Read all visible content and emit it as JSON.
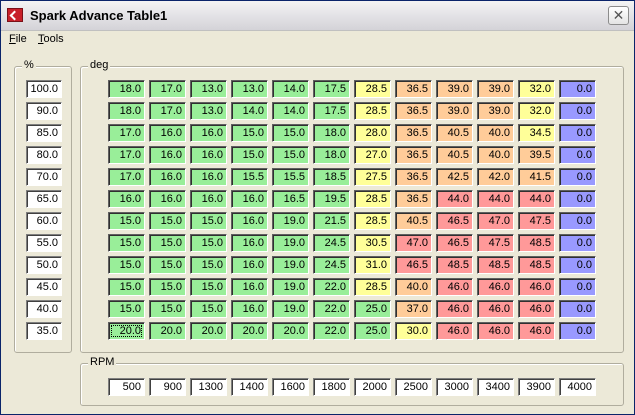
{
  "window": {
    "title": "Spark Advance Table1",
    "close_glyph": "✕"
  },
  "menu": [
    {
      "key": "F",
      "rest": "ile"
    },
    {
      "key": "T",
      "rest": "ools"
    }
  ],
  "groups": {
    "percent_label": "%",
    "table_label": "deg",
    "rpm_label": "RPM"
  },
  "percent": [
    "100.0",
    "90.0",
    "85.0",
    "80.0",
    "70.0",
    "65.0",
    "60.0",
    "55.0",
    "50.0",
    "45.0",
    "40.0",
    "35.0"
  ],
  "rpm": [
    "500",
    "900",
    "1300",
    "1400",
    "1600",
    "1800",
    "2000",
    "2500",
    "3000",
    "3400",
    "3900",
    "4000"
  ],
  "table": [
    [
      "18.0",
      "17.0",
      "13.0",
      "13.0",
      "14.0",
      "17.5",
      "28.5",
      "36.5",
      "39.0",
      "39.0",
      "32.0",
      "0.0"
    ],
    [
      "18.0",
      "17.0",
      "13.0",
      "14.0",
      "14.0",
      "17.5",
      "28.5",
      "36.5",
      "39.0",
      "39.0",
      "32.0",
      "0.0"
    ],
    [
      "17.0",
      "16.0",
      "16.0",
      "15.0",
      "15.0",
      "18.0",
      "28.0",
      "36.5",
      "40.5",
      "40.0",
      "34.5",
      "0.0"
    ],
    [
      "17.0",
      "16.0",
      "16.0",
      "15.0",
      "15.0",
      "18.0",
      "27.0",
      "36.5",
      "40.5",
      "40.0",
      "39.5",
      "0.0"
    ],
    [
      "17.0",
      "16.0",
      "16.0",
      "15.5",
      "15.5",
      "18.5",
      "27.5",
      "36.5",
      "42.5",
      "42.0",
      "41.5",
      "0.0"
    ],
    [
      "16.0",
      "16.0",
      "16.0",
      "16.0",
      "16.5",
      "19.5",
      "28.5",
      "36.5",
      "44.0",
      "44.0",
      "44.0",
      "0.0"
    ],
    [
      "15.0",
      "15.0",
      "15.0",
      "16.0",
      "19.0",
      "21.5",
      "28.5",
      "40.5",
      "46.5",
      "47.0",
      "47.5",
      "0.0"
    ],
    [
      "15.0",
      "15.0",
      "15.0",
      "16.0",
      "19.0",
      "24.5",
      "30.5",
      "47.0",
      "46.5",
      "47.5",
      "48.5",
      "0.0"
    ],
    [
      "15.0",
      "15.0",
      "15.0",
      "16.0",
      "19.0",
      "24.5",
      "31.0",
      "46.5",
      "48.5",
      "48.5",
      "48.5",
      "0.0"
    ],
    [
      "15.0",
      "15.0",
      "15.0",
      "16.0",
      "19.0",
      "22.0",
      "28.5",
      "40.0",
      "46.0",
      "46.0",
      "46.0",
      "0.0"
    ],
    [
      "15.0",
      "15.0",
      "15.0",
      "16.0",
      "19.0",
      "22.0",
      "25.0",
      "37.0",
      "46.0",
      "46.0",
      "46.0",
      "0.0"
    ],
    [
      "20.0",
      "20.0",
      "20.0",
      "20.0",
      "20.0",
      "22.0",
      "25.0",
      "30.0",
      "46.0",
      "46.0",
      "46.0",
      "0.0"
    ]
  ],
  "selected_cell": {
    "row": 11,
    "col": 0
  },
  "colors": {
    "green": "#99ee99",
    "yellow": "#ffff99",
    "orange": "#ffcc99",
    "red": "#ff9999",
    "blue": "#9999ff"
  },
  "icon": "app-flag-icon"
}
